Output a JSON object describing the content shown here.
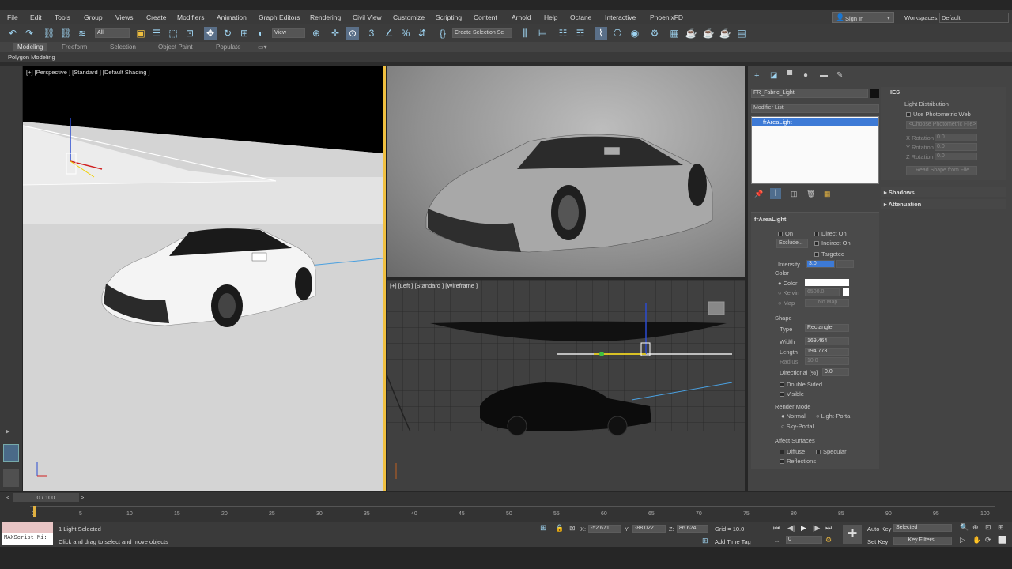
{
  "menu": [
    "File",
    "Edit",
    "Tools",
    "Group",
    "Views",
    "Create",
    "Modifiers",
    "Animation",
    "Graph Editors",
    "Rendering",
    "Civil View",
    "Customize",
    "Scripting",
    "Content",
    "Arnold",
    "Help",
    "Octane",
    "Interactive",
    "PhoenixFD"
  ],
  "account": {
    "sign_in": "Sign In",
    "workspaces_label": "Workspaces:",
    "workspace": "Default"
  },
  "toolbar": {
    "filter": "All",
    "ref_coord": "View",
    "selection_set": "Create Selection Se"
  },
  "ribbon": {
    "tabs": [
      "Modeling",
      "Freeform",
      "Selection",
      "Object Paint",
      "Populate"
    ],
    "sub": "Polygon Modeling"
  },
  "viewports": {
    "persp": "[+] [Perspective ] [Standard ] [Default Shading ]",
    "left": "[+] [Left ] [Standard ] [Wireframe ]"
  },
  "panel": {
    "object_name": "FR_Fabric_Light",
    "modifier_list": "Modifier List",
    "stack_item": "frAreaLight",
    "rollout": "frAreaLight",
    "on": "On",
    "exclude": "Exclude...",
    "direct_on": "Direct On",
    "indirect_on": "Indirect On",
    "targeted": "Targeted",
    "intensity_label": "Intensity",
    "intensity": "3.0",
    "color_group": "Color",
    "color": "Color",
    "kelvin": "Kelvin",
    "kelvin_val": "6500.0",
    "map": "Map",
    "no_map": "No Map",
    "shape_group": "Shape",
    "type_label": "Type",
    "type": "Rectangle",
    "width_label": "Width",
    "width": "169.464",
    "length_label": "Length",
    "length": "194.773",
    "radius_label": "Radius",
    "radius": "10.0",
    "directional_label": "Directional [%]",
    "directional": "0.0",
    "double_sided": "Double Sided",
    "visible": "Visible",
    "render_mode": "Render Mode",
    "normal": "Normal",
    "light_portal": "Light-Porta",
    "sky_portal": "Sky-Portal",
    "affect": "Affect Surfaces",
    "diffuse": "Diffuse",
    "specular": "Specular",
    "reflections": "Reflections",
    "ies": "IES",
    "light_dist": "Light Distribution",
    "use_web": "Use Photometric Web",
    "choose_file": "<Choose Photometric File>",
    "xrot": "X Rotation",
    "yrot": "Y Rotation",
    "zrot": "Z Rotation",
    "rot_val": "0.0",
    "read_shape": "Read Shape from File",
    "shadows": "Shadows",
    "attenuation": "Attenuation"
  },
  "timeline": {
    "frame": "0 / 100",
    "ticks": [
      "0",
      "5",
      "10",
      "15",
      "20",
      "25",
      "30",
      "35",
      "40",
      "45",
      "50",
      "55",
      "60",
      "65",
      "70",
      "75",
      "80",
      "85",
      "90",
      "95",
      "100"
    ]
  },
  "status": {
    "maxscript": "MAXScript Mi:",
    "selected": "1 Light Selected",
    "hint": "Click and drag to select and move objects",
    "x": "-52.671",
    "y": "-88.022",
    "z": "86.624",
    "grid": "Grid = 10.0",
    "add_time_tag": "Add Time Tag",
    "auto_key": "Auto Key",
    "set_key": "Set Key",
    "selected_dd": "Selected",
    "key_filters": "Key Filters...",
    "frame": "0"
  }
}
